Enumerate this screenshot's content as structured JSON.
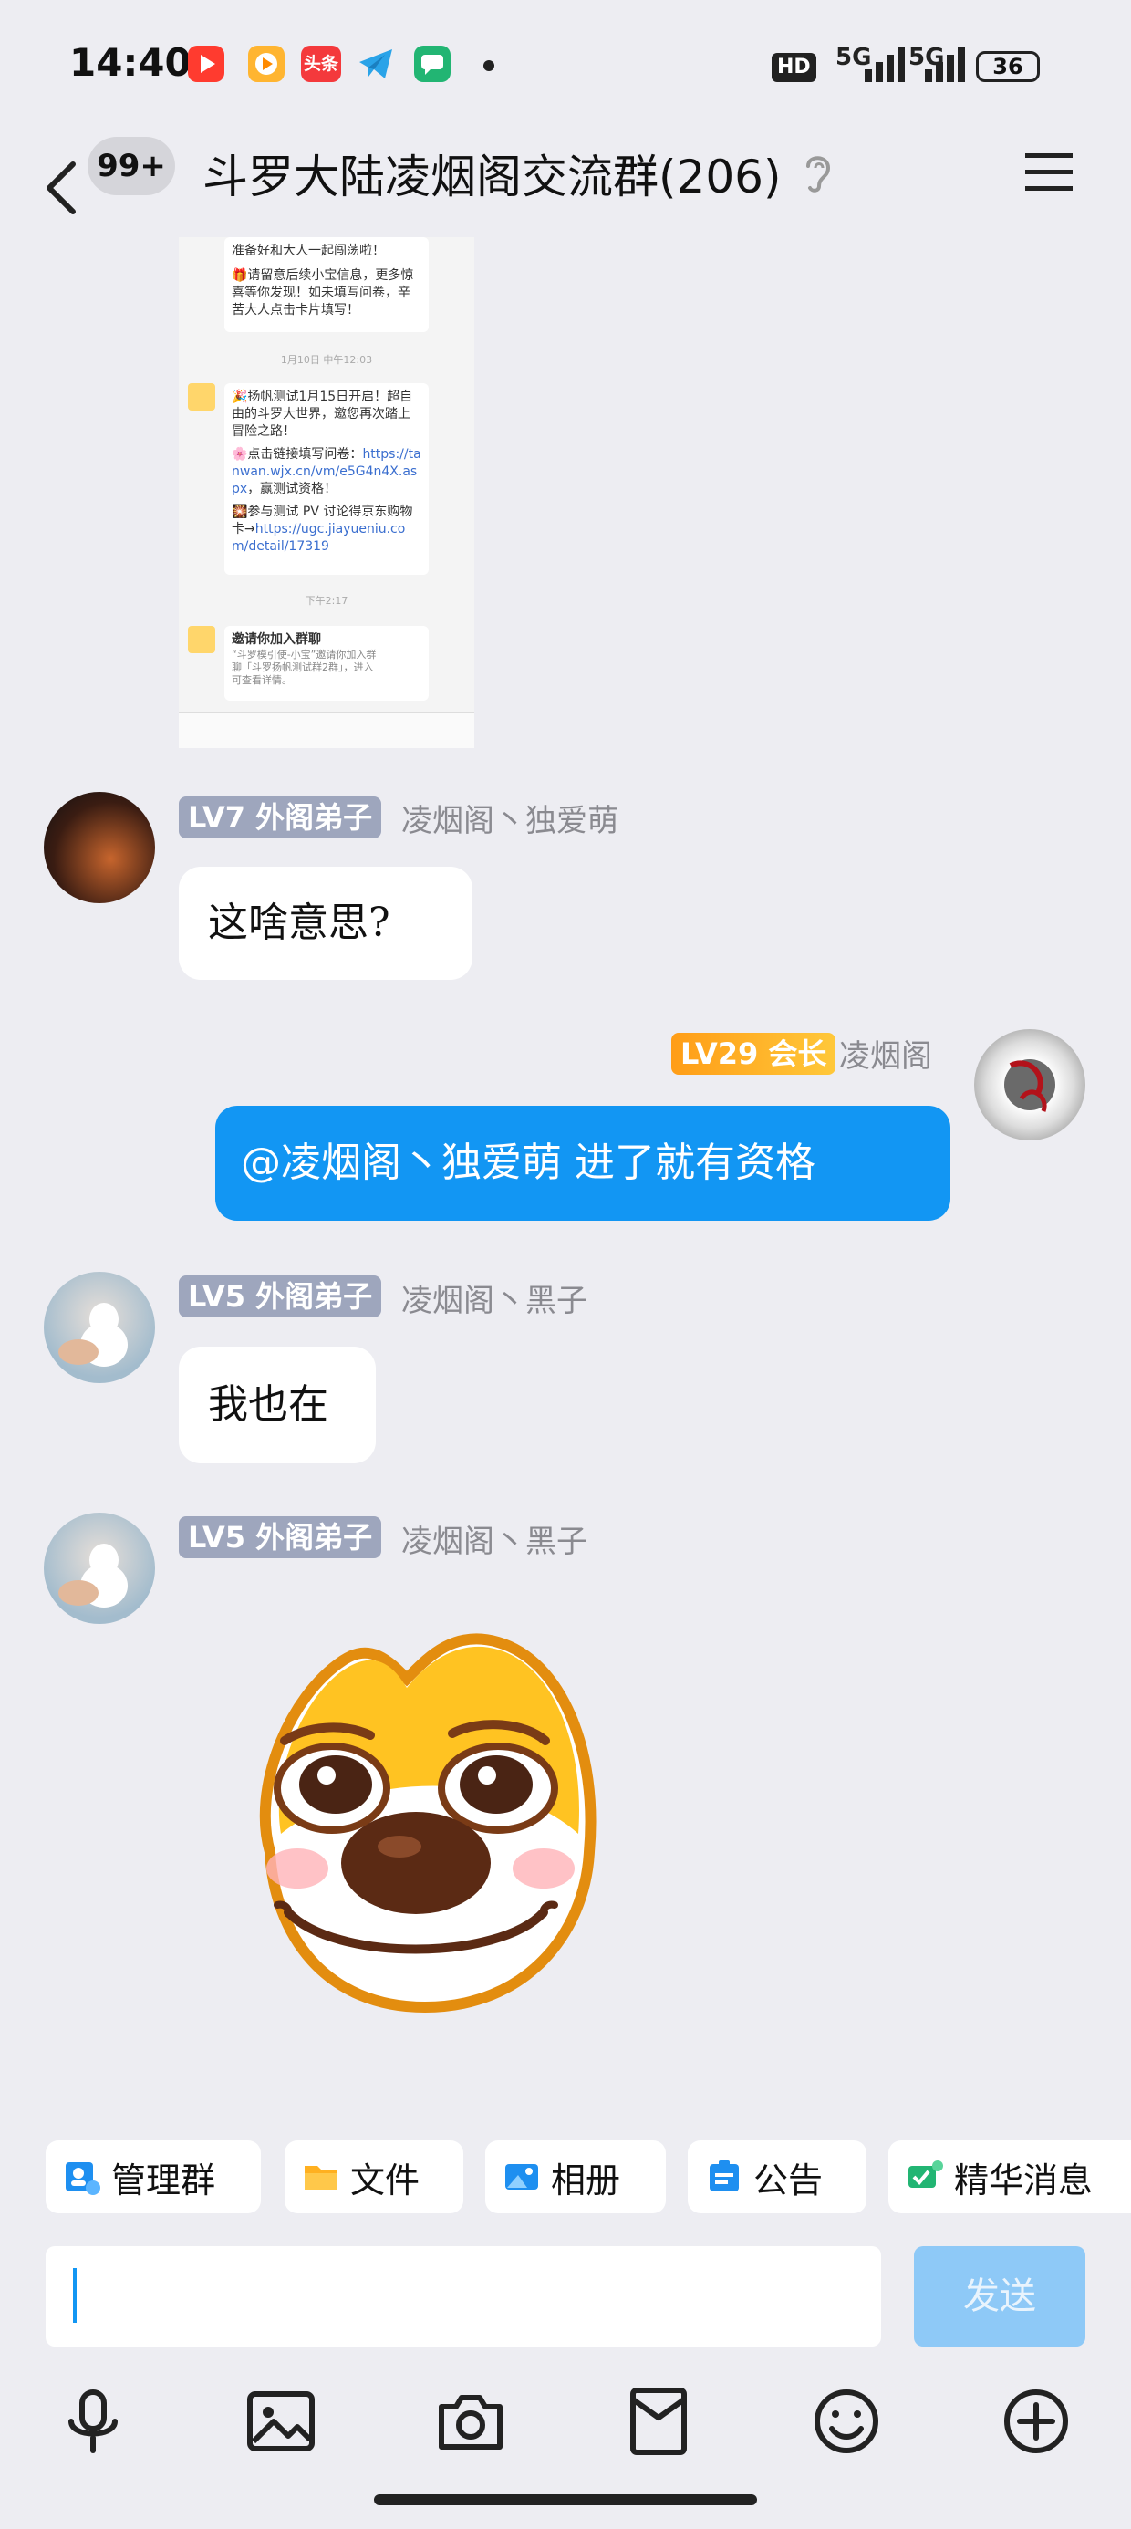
{
  "status_bar": {
    "time": "14:40",
    "toutiao": "头条",
    "hd": "HD",
    "net1": "5G",
    "net2": "5G",
    "battery": "36"
  },
  "header": {
    "unread": "99+",
    "title": "斗罗大陆凌烟阁交流群(206)"
  },
  "shot": {
    "b1": "准备好和大人一起闯荡啦！",
    "b1b": "🎁请留意后续小宝信息，更多惊喜等你发现！如未填写问卷，辛苦大人点击卡片填写！",
    "t1": "1月10日 中午12:03",
    "b2a": "🎉扬帆测试1月15日开启！超自由的斗罗大世界，邀您再次踏上冒险之路！",
    "b2b": "🌸点击链接填写问卷：",
    "b2link": "https://tanwan.wjx.cn/vm/e5G4n4X.aspx",
    "b2c": "，赢测试资格！",
    "b2d": "🎇参与测试 PV 讨论得京东购物卡→",
    "b2link2": "https://ugc.jiayueniu.com/detail/17319",
    "t2": "下午2:17",
    "b3a": "邀请你加入群聊",
    "b3b": "“斗罗模引使-小宝”邀请你加入群聊「斗罗扬帆测试群2群」，进入可查看详情。"
  },
  "messages": [
    {
      "level": "LV7",
      "title": "外阁弟子",
      "nick": "凌烟阁丶独爱萌",
      "text": "这啥意思?"
    },
    {
      "level": "LV29",
      "title": "会长",
      "nick": "凌烟阁",
      "text": "@凌烟阁丶独爱萌 进了就有资格"
    },
    {
      "level": "LV5",
      "title": "外阁弟子",
      "nick": "凌烟阁丶黑子",
      "text": "我也在"
    },
    {
      "level": "LV5",
      "title": "外阁弟子",
      "nick": "凌烟阁丶黑子",
      "sticker": "dog-face-sticker"
    }
  ],
  "quick_actions": [
    "管理群",
    "文件",
    "相册",
    "公告",
    "精华消息"
  ],
  "composer": {
    "send": "发送"
  },
  "icons": [
    "back-icon",
    "ear-icon",
    "menu-icon",
    "mic-icon",
    "image-icon",
    "camera-icon",
    "red-packet-icon",
    "emoji-icon",
    "plus-icon"
  ],
  "colors": {
    "accent": "#1296f3",
    "badge_grey": "#9ea6bd",
    "badge_gold": "#ffb020",
    "background": "#ededf2"
  }
}
